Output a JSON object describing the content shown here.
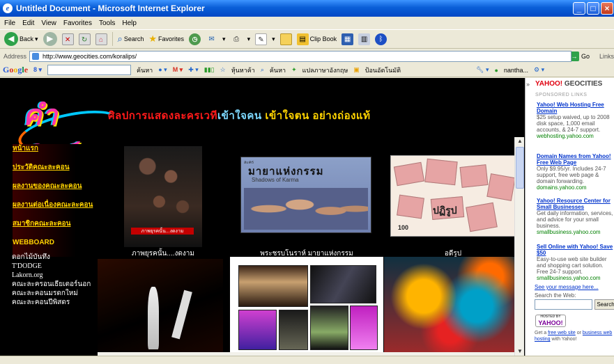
{
  "window": {
    "title": "Untitled Document - Microsoft Internet Explorer",
    "min": "_",
    "max": "□",
    "close": "×"
  },
  "menu": [
    "File",
    "Edit",
    "View",
    "Favorites",
    "Tools",
    "Help"
  ],
  "toolbar": {
    "back": "Back",
    "search": "Search",
    "favorites": "Favorites",
    "clip_book": "Clip Book"
  },
  "address": {
    "label": "Address",
    "url": "http://www.geocities.com/koralips/",
    "go": "Go",
    "links": "Links"
  },
  "googlebar": {
    "brand": "Google",
    "search_btn": "ค้นหา",
    "pagerank": "หุ้นหาค้า",
    "search2": "ค้นหา",
    "translate": "แปลภาษาอังกฤษ",
    "options": "ป้อนอัตโนมัติ",
    "account": "nantha..."
  },
  "site": {
    "logo": "คำศิลป์",
    "slogan_1": "ศิลปการแสดงละครเวที",
    "slogan_2": "เข้าใจคน",
    "slogan_3": "เข้าใจตน",
    "slogan_4": "อย่างถ่องแท้",
    "nav": [
      "หน้าแรก",
      "ประวัติคณะละคอน",
      "ผลงานของคณะละคอน",
      "ผลงานต่อเนื่องคณะละคอน",
      "สมาชิกคณะละคอน",
      "WEBBOARD"
    ],
    "links": [
      "ดอกไม้บันทึง",
      "T'DODGE",
      "Lakorn.org",
      "คณะละครอนเธียเตอร์นอก",
      "คณะละคอนมรดกใหม่",
      "คณะละคอนปีพิสดร"
    ],
    "photos": [
      {
        "caption": "ภาพยุรคนั้น....งดงาม",
        "poster_text": "ภาพยุรคนั้น...งดงาม"
      },
      {
        "caption": "พระชรบโนราห์ มายาแห่งกรรม",
        "title": "มายาแห่งกรรม",
        "subtitle": "Shadows of Karma",
        "small": "ละคร"
      },
      {
        "caption": "อดีรูป",
        "label": "ปฏิรูป",
        "number": "100"
      }
    ]
  },
  "yahoo": {
    "brand_y": "YAHOO!",
    "brand_g": "GEOCITIES",
    "sponsored": "SPONSORED LINKS",
    "ads": [
      {
        "title": "Yahoo! Web Hosting Free Domain",
        "body": "$25 setup waived, up to 2008 disk space, 1,000 email accounts, & 24-7 support.",
        "url": "webhosting.yahoo.com"
      },
      {
        "title": "Domain Names from Yahoo! Free Web Page",
        "body": "Only $9.95/yr. Includes 24-7 support, free web page & domain forwarding.",
        "url": "domains.yahoo.com"
      },
      {
        "title": "Yahoo! Resource Center for Small Businesses",
        "body": "Get daily information, services, and advice for your small business.",
        "url": "smallbusiness.yahoo.com"
      },
      {
        "title": "Sell Online with Yahoo! Save $50",
        "body": "Easy-to-use web site builder and shopping cart solution. Free 24-7 support.",
        "url": "smallbusiness.yahoo.com"
      }
    ],
    "see_message": "See your message here...",
    "search_web": "Search the Web:",
    "search_btn": "Search",
    "hosted_by": "HOSTED BY",
    "hosted_brand": "YAHOO!",
    "foot_prefix": "Get a ",
    "foot_link1": "free web site",
    "foot_mid": " or ",
    "foot_link2": "business web hosting",
    "foot_suffix": " with Yahoo!"
  }
}
